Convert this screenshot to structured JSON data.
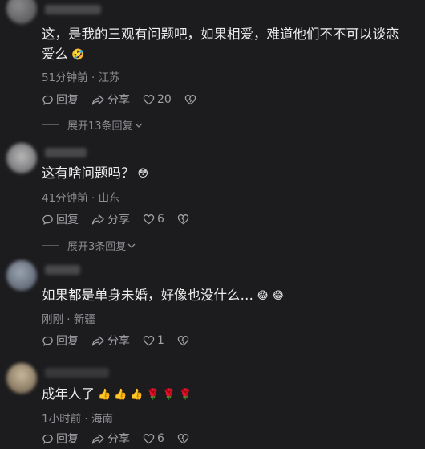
{
  "comments": [
    {
      "text": "这，是我的三观有问题吧，如果相爱，难道他们不不可以谈恋爱么",
      "emojis": [
        "🤣"
      ],
      "time": "51分钟前",
      "location": "江苏",
      "reply_label": "回复",
      "share_label": "分享",
      "likes": "20",
      "expand": "展开13条回复"
    },
    {
      "text": "这有啥问题吗？",
      "emojis": [
        "😳"
      ],
      "time": "41分钟前",
      "location": "山东",
      "reply_label": "回复",
      "share_label": "分享",
      "likes": "6",
      "expand": "展开3条回复"
    },
    {
      "text": "如果都是单身未婚，好像也没什么…",
      "emojis": [
        "😂",
        "😂"
      ],
      "time": "刚刚",
      "location": "新疆",
      "reply_label": "回复",
      "share_label": "分享",
      "likes": "1"
    },
    {
      "text": "成年人了",
      "emojis": [
        "👍",
        "👍",
        "👍",
        "🌹",
        "🌹",
        "🌹"
      ],
      "time": "1小时前",
      "location": "海南",
      "reply_label": "回复",
      "share_label": "分享",
      "likes": "6"
    }
  ],
  "separator": " · "
}
